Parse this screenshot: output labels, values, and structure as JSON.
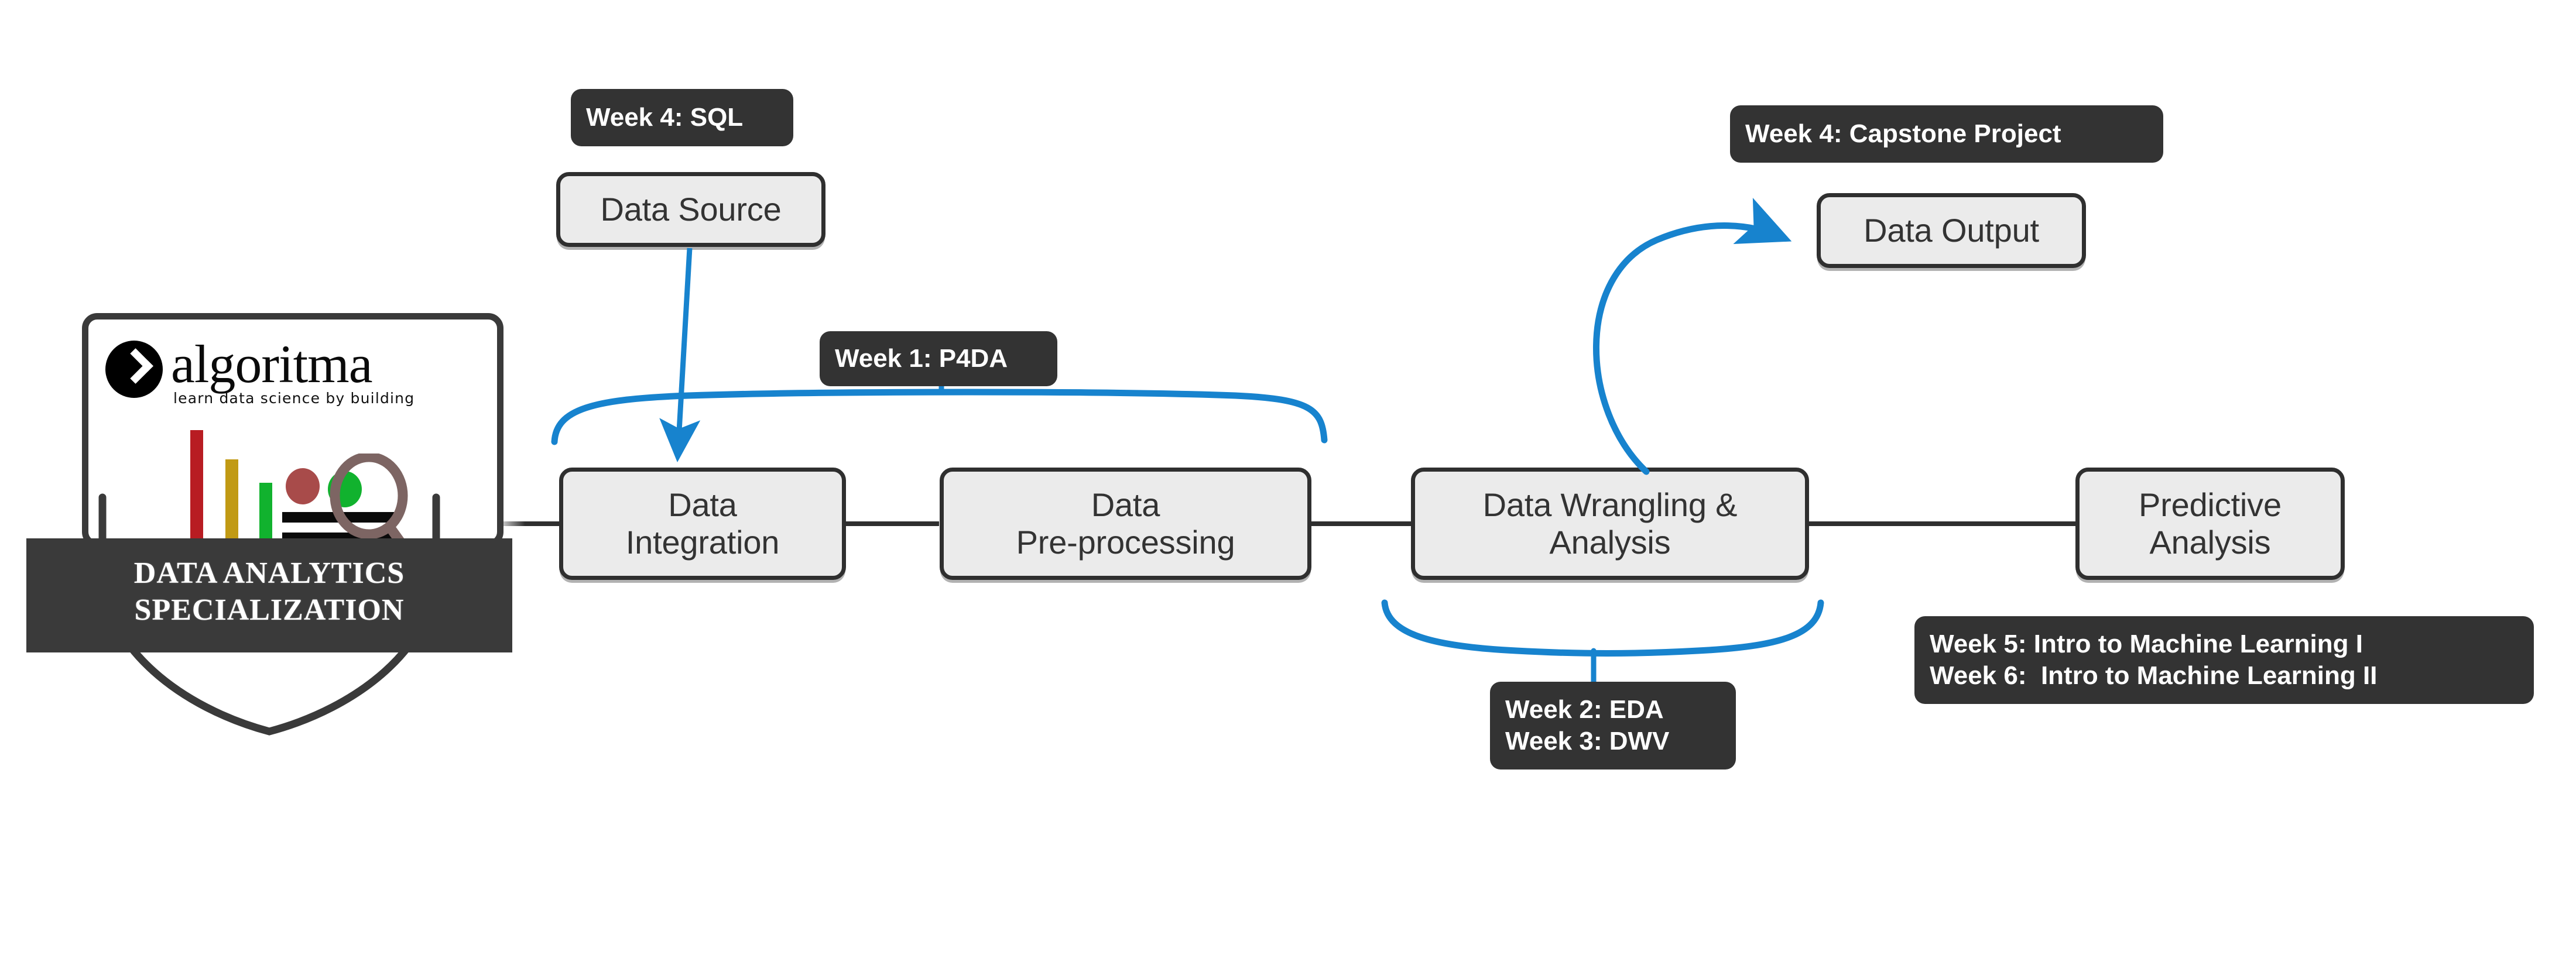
{
  "badge": {
    "logo_word": "algoritma",
    "logo_tagline": "learn data science by building",
    "ribbon_line1": "DATA ANALYTICS",
    "ribbon_line2": "SPECIALIZATION",
    "colors": {
      "bar_red": "#B81C22",
      "bar_gold": "#C19A14",
      "bar_green": "#11B22E",
      "dot_red": "#A84B4A",
      "dot_green": "#11B22E",
      "magnifier": "#7D6563",
      "dark": "#3a3a3a"
    }
  },
  "flow": {
    "nodes": [
      {
        "id": "data-source",
        "label": "Data Source"
      },
      {
        "id": "data-integration",
        "label_line1": "Data",
        "label_line2": "Integration"
      },
      {
        "id": "data-preprocessing",
        "label_line1": "Data",
        "label_line2": "Pre-processing"
      },
      {
        "id": "data-wrangling",
        "label_line1": "Data Wrangling &",
        "label_line2": "Analysis"
      },
      {
        "id": "predictive-analysis",
        "label_line1": "Predictive",
        "label_line2": "Analysis"
      },
      {
        "id": "data-output",
        "label": "Data Output"
      }
    ]
  },
  "labels": {
    "week4_sql": "Week 4: SQL",
    "week1_p4da": "Week 1: P4DA",
    "week4_capstone": "Week 4: Capstone Project",
    "week23_line1": "Week 2: EDA",
    "week23_line2": "Week 3: DWV",
    "week56_line1": "Week 5: Intro to Machine Learning I",
    "week56_line2": "Week 6:  Intro to Machine Learning II"
  },
  "colors": {
    "accent_blue": "#1783CE",
    "node_fill": "#ebebeb",
    "node_stroke": "#2f2f2f",
    "label_bg": "#333333",
    "label_text": "#ffffff"
  }
}
